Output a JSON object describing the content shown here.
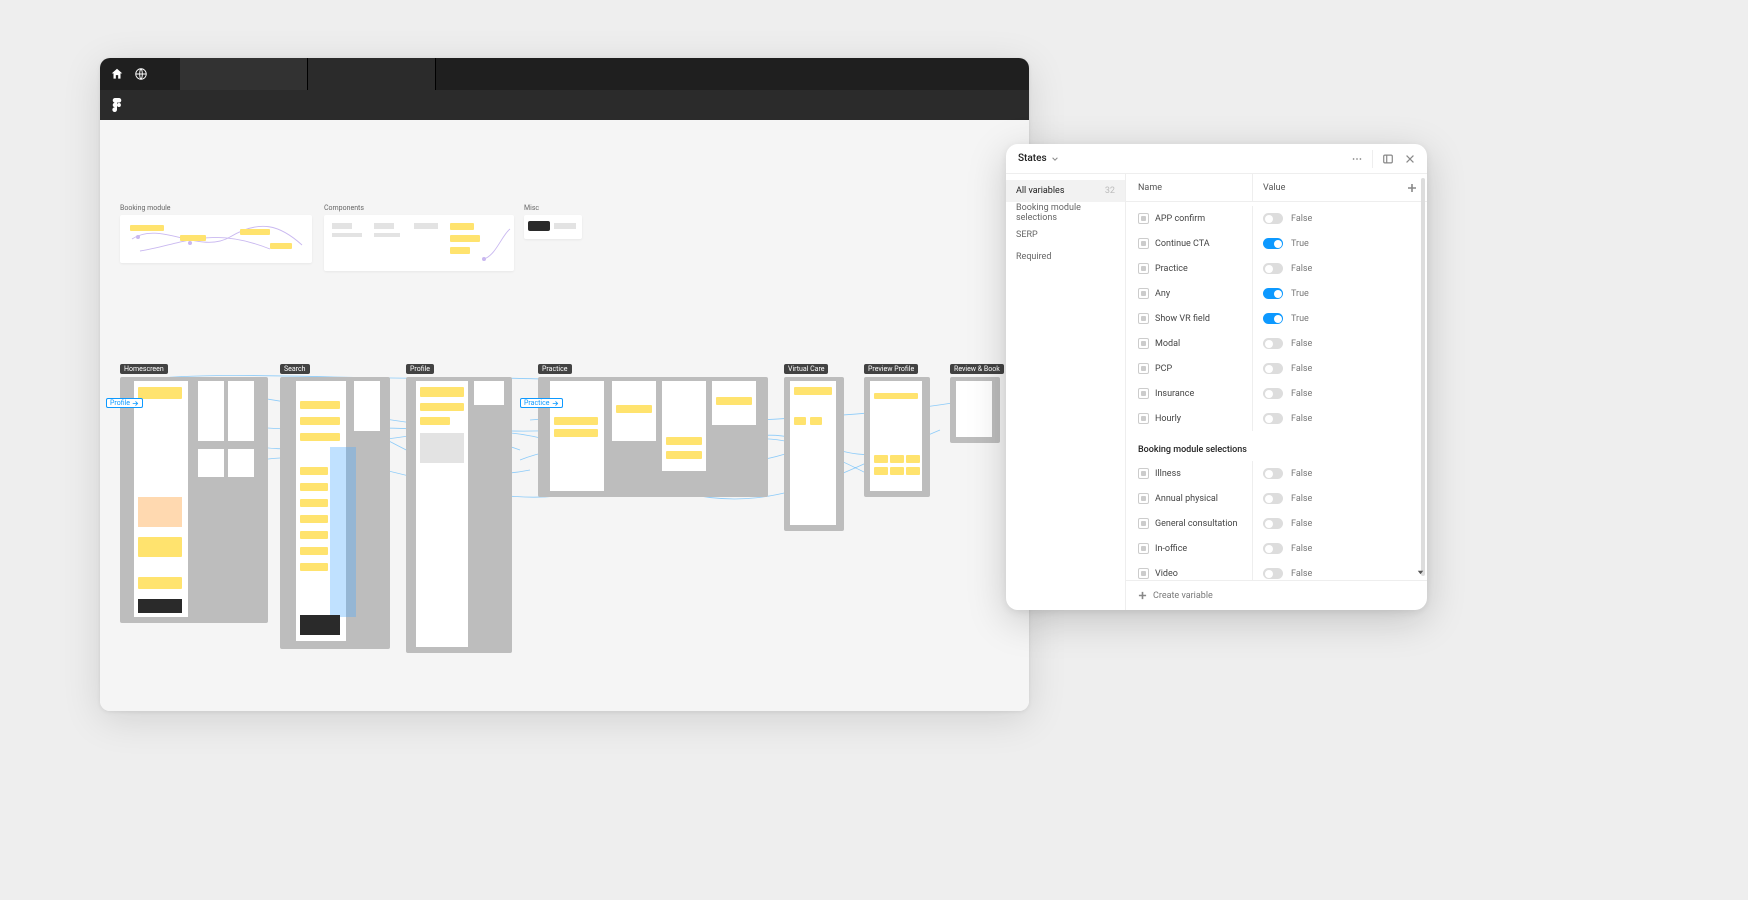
{
  "canvas": {
    "top_panels": {
      "booking": "Booking module",
      "components": "Components",
      "misc": "Misc"
    },
    "flow_frames": [
      "Homescreen",
      "Search",
      "Profile",
      "Practice",
      "Virtual Care",
      "Preview Profile",
      "Review & Book"
    ],
    "floating_tags": {
      "profile": "Profile",
      "practice": "Practice"
    }
  },
  "panel": {
    "title": "States",
    "columns": {
      "name": "Name",
      "value": "Value"
    },
    "sidebar": [
      {
        "label": "All variables",
        "count": "32",
        "active": true
      },
      {
        "label": "Booking module selections",
        "count": "",
        "active": false
      },
      {
        "label": "SERP",
        "count": "",
        "active": false
      },
      {
        "label": "Required",
        "count": "",
        "active": false
      }
    ],
    "vars": [
      {
        "name": "APP confirm",
        "value": "False",
        "on": false
      },
      {
        "name": "Continue CTA",
        "value": "True",
        "on": true
      },
      {
        "name": "Practice",
        "value": "False",
        "on": false
      },
      {
        "name": "Any",
        "value": "True",
        "on": true
      },
      {
        "name": "Show VR field",
        "value": "True",
        "on": true
      },
      {
        "name": "Modal",
        "value": "False",
        "on": false
      },
      {
        "name": "PCP",
        "value": "False",
        "on": false
      },
      {
        "name": "Insurance",
        "value": "False",
        "on": false
      },
      {
        "name": "Hourly",
        "value": "False",
        "on": false
      }
    ],
    "section2_title": "Booking module selections",
    "vars2": [
      {
        "name": "Illness",
        "value": "False",
        "on": false
      },
      {
        "name": "Annual physical",
        "value": "False",
        "on": false
      },
      {
        "name": "General consultation",
        "value": "False",
        "on": false
      },
      {
        "name": "In-office",
        "value": "False",
        "on": false
      },
      {
        "name": "Video",
        "value": "False",
        "on": false
      }
    ],
    "create": "Create variable"
  }
}
